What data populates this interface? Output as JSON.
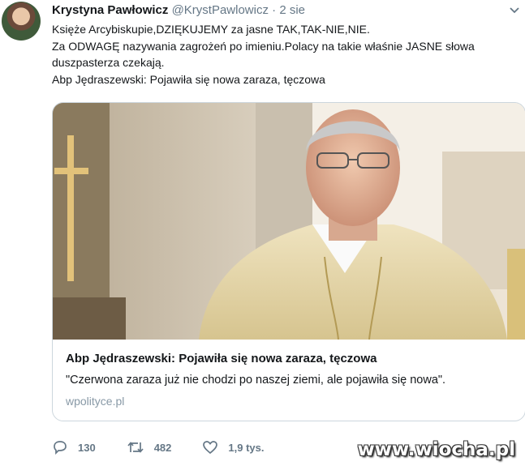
{
  "tweet": {
    "author_name": "Krystyna Pawłowicz",
    "author_handle": "@KrystPawlowicz",
    "separator": "·",
    "time": "2 sie",
    "lines": [
      "Księże Arcybiskupie,DZIĘKUJEMY za jasne TAK,TAK-NIE,NIE.",
      "Za ODWAGĘ nazywania zagrożeń po imieniu.Polacy na takie właśnie JASNE słowa duszpasterza czekają.",
      "Abp Jędraszewski: Pojawiła się nowa zaraza, tęczowa"
    ]
  },
  "card": {
    "title": "Abp Jędraszewski: Pojawiła się nowa zaraza, tęczowa",
    "description": "\"Czerwona zaraza już nie chodzi po naszej ziemi, ale pojawiła się nowa\".",
    "domain": "wpolityce.pl"
  },
  "actions": {
    "replies": "130",
    "retweets": "482",
    "likes": "1,9 tys."
  },
  "watermark": "www.wiocha.pl",
  "icons": {
    "reply": "reply-icon",
    "retweet": "retweet-icon",
    "like": "heart-icon",
    "menu": "chevron-down-icon"
  },
  "colors": {
    "text": "#14171a",
    "secondary": "#657786",
    "border": "#ccd6dd",
    "domain": "#8899a6"
  }
}
